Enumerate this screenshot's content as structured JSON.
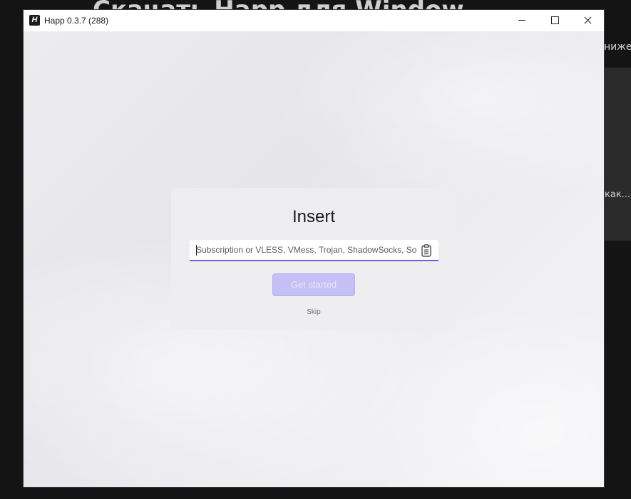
{
  "background_page": {
    "heading": "Скачать Happ для Windows",
    "right_top_text": "ниже",
    "panel_text": "как...»"
  },
  "window": {
    "title": "Happ 0.3.7 (288)",
    "icon": "happ-logo-icon",
    "icon_letter": "H",
    "controls": {
      "minimize": "minimize-icon",
      "maximize": "maximize-icon",
      "close": "close-icon"
    }
  },
  "onboarding": {
    "title": "Insert",
    "input": {
      "value": "",
      "placeholder": "Subscription or VLESS, VMess, Trojan, ShadowSocks, Socks",
      "trailing_icon": "clipboard-paste-icon"
    },
    "primary_button": "Get started",
    "secondary_link": "Skip"
  },
  "colors": {
    "accent": "#6b5fe6",
    "button_disabled_bg": "#c4c0f5",
    "window_bg": "#f0f0f3",
    "page_bg": "#141414"
  }
}
